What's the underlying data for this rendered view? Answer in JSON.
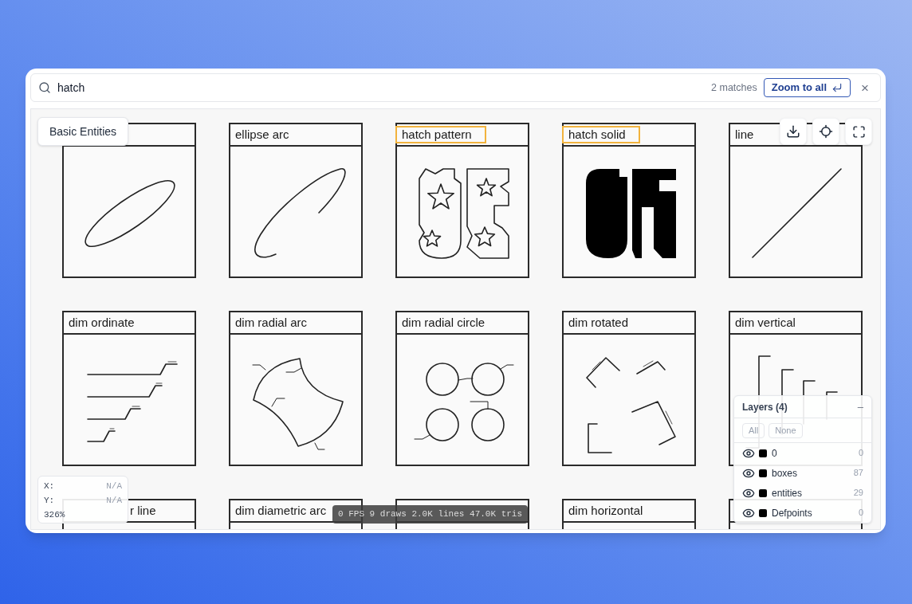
{
  "search": {
    "value": "hatch",
    "matches": "2 matches",
    "zoom_button": "Zoom to all",
    "close": "×"
  },
  "canvas": {
    "label": "Basic Entities",
    "cards": [
      {
        "kind": "ellipse",
        "matched": false
      },
      {
        "title": "ellipse arc",
        "kind": "ellipse_arc",
        "matched": false
      },
      {
        "title": "hatch pattern",
        "kind": "hatch_pattern",
        "matched": true
      },
      {
        "title": "hatch solid",
        "kind": "hatch_solid",
        "matched": true
      },
      {
        "title": "line",
        "kind": "line",
        "matched": false
      },
      {
        "title": "dim ordinate",
        "kind": "dim_ordinate",
        "matched": false
      },
      {
        "title": "dim radial arc",
        "kind": "dim_radial_arc",
        "matched": false
      },
      {
        "title": "dim radial circle",
        "kind": "dim_radial_circle",
        "matched": false
      },
      {
        "title": "dim rotated",
        "kind": "dim_rotated",
        "matched": false
      },
      {
        "title": "dim vertical",
        "kind": "dim_vertical",
        "matched": false
      },
      {
        "title": "r line",
        "matched": false
      },
      {
        "title": "dim diametric arc",
        "matched": false
      },
      {
        "matched": false
      },
      {
        "title": "dim horizontal",
        "matched": false
      },
      {
        "matched": false
      }
    ]
  },
  "coordinates": {
    "x_label": "X:",
    "x_value": "N/A",
    "y_label": "Y:",
    "y_value": "N/A",
    "zoom": "326%"
  },
  "stats": "0 FPS 9 draws 2.0K lines 47.0K tris",
  "layers": {
    "title": "Layers (4)",
    "collapse": "–",
    "buttons": [
      "All",
      "None"
    ],
    "items": [
      {
        "name": "0",
        "count": "0",
        "color": "#000000",
        "visible": true
      },
      {
        "name": "boxes",
        "count": "87",
        "color": "#000000",
        "visible": true
      },
      {
        "name": "entities",
        "count": "29",
        "color": "#000000",
        "visible": true
      },
      {
        "name": "Defpoints",
        "count": "0",
        "color": "#000000",
        "visible": true
      }
    ]
  }
}
